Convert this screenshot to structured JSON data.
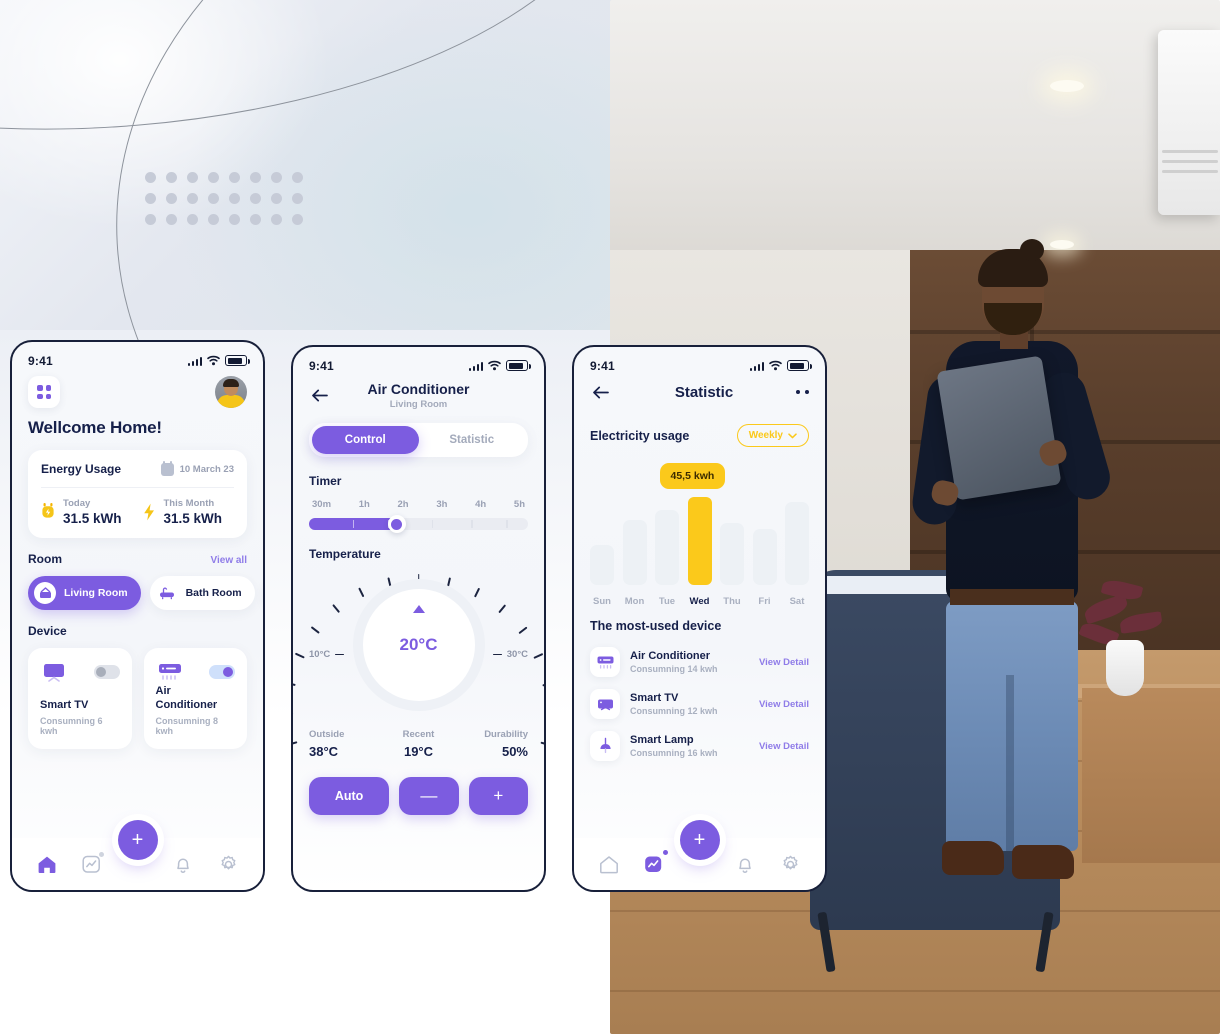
{
  "background": {
    "decor": {
      "dot_grid_cols": 8,
      "dot_grid_rows": 3
    }
  },
  "phone1": {
    "name": "home-screen",
    "status": {
      "time": "9:41",
      "icons": [
        "signal-icon",
        "wifi-icon",
        "battery-icon"
      ]
    },
    "header": {
      "menu_icon": "grid-icon",
      "avatar": "user-avatar",
      "greeting": "Wellcome Home!"
    },
    "energy": {
      "title": "Energy Usage",
      "date": "10 March 23",
      "date_icon": "calendar-icon",
      "stats": [
        {
          "icon": "plug-icon",
          "label": "Today",
          "value": "31.5 kWh"
        },
        {
          "icon": "bolt-icon",
          "label": "This Month",
          "value": "31.5 kWh"
        }
      ]
    },
    "room_section": {
      "title": "Room",
      "view_all": "View all"
    },
    "rooms": [
      {
        "label": "Living Room",
        "icon": "living-room-icon",
        "active": true
      },
      {
        "label": "Bath Room",
        "icon": "bath-room-icon",
        "active": false
      },
      {
        "label": "",
        "icon": "room-icon",
        "active": false
      }
    ],
    "device_section": {
      "title": "Device"
    },
    "devices": [
      {
        "name": "Smart TV",
        "consumption": "Consumning 6 kwh",
        "icon": "tv-icon",
        "toggle": "off"
      },
      {
        "name": "Air Conditioner",
        "consumption": "Consumning 8 kwh",
        "icon": "air-conditioner-icon",
        "toggle": "on"
      }
    ],
    "nav": {
      "fab_label": "+",
      "items": [
        {
          "icon": "home-icon",
          "active": true
        },
        {
          "icon": "statistics-icon",
          "active": false,
          "badge": true
        },
        {
          "icon": "bell-icon",
          "active": false
        },
        {
          "icon": "gear-icon",
          "active": false
        }
      ]
    }
  },
  "phone2": {
    "name": "air-conditioner-control-screen",
    "status": {
      "time": "9:41"
    },
    "header": {
      "back_icon": "back-arrow-icon",
      "title": "Air Conditioner",
      "subtitle": "Living Room"
    },
    "tabs": [
      {
        "label": "Control",
        "active": true
      },
      {
        "label": "Statistic",
        "active": false
      }
    ],
    "timer": {
      "title": "Timer",
      "options": [
        "30m",
        "1h",
        "2h",
        "3h",
        "4h",
        "5h"
      ],
      "selected": "2h",
      "fill_percent": 40
    },
    "temperature": {
      "title": "Temperature",
      "value": "20°C",
      "min": "10°C",
      "max": "30°C",
      "indicator_icon": "dial-pointer-icon"
    },
    "metrics": [
      {
        "label": "Outside",
        "value": "38°C"
      },
      {
        "label": "Recent",
        "value": "19°C"
      },
      {
        "label": "Durability",
        "value": "50%"
      }
    ],
    "actions": [
      {
        "label": "Auto",
        "name": "auto-button"
      },
      {
        "label": "—",
        "name": "decrease-button"
      },
      {
        "label": "+",
        "name": "increase-button"
      }
    ]
  },
  "phone3": {
    "name": "statistic-screen",
    "status": {
      "time": "9:41"
    },
    "header": {
      "back_icon": "back-arrow-icon",
      "title": "Statistic",
      "more_icon": "more-options-icon"
    },
    "section": {
      "title": "Electricity usage",
      "filter": "Weekly",
      "filter_icon": "chevron-down-icon",
      "filter_color": "#fbc91b"
    },
    "most_used": {
      "title": "The most-used device"
    },
    "device_rows": [
      {
        "name": "Air Conditioner",
        "consumption": "Consumning 14 kwh",
        "action": "View Detail",
        "icon": "air-conditioner-icon"
      },
      {
        "name": "Smart TV",
        "consumption": "Consumning 12 kwh",
        "action": "View Detail",
        "icon": "tv-icon"
      },
      {
        "name": "Smart Lamp",
        "consumption": "Consumning 16 kwh",
        "action": "View Detail",
        "icon": "lamp-icon"
      }
    ],
    "nav": {
      "fab_label": "+",
      "items": [
        {
          "icon": "home-icon",
          "active": false
        },
        {
          "icon": "statistics-icon",
          "active": true,
          "badge": true
        },
        {
          "icon": "bell-icon",
          "active": false
        },
        {
          "icon": "gear-icon",
          "active": false
        }
      ]
    }
  },
  "chart_data": {
    "type": "bar",
    "title": "Electricity usage",
    "xlabel": "",
    "ylabel": "kwh",
    "categories": [
      "Sun",
      "Mon",
      "Tue",
      "Wed",
      "Thu",
      "Fri",
      "Sat"
    ],
    "values": [
      21,
      34,
      39,
      45.5,
      32,
      29,
      43
    ],
    "highlight_index": 3,
    "highlight_label": "45,5 kwh",
    "highlight_color": "#fbc91b",
    "base_color": "#edf1f5",
    "ylim": [
      0,
      52
    ],
    "grid": false,
    "legend": "none"
  },
  "colors": {
    "accent_purple": "#7c5ce0",
    "accent_yellow": "#fbc91b",
    "text_dark": "#16204a",
    "text_muted": "#a9b0c0"
  }
}
